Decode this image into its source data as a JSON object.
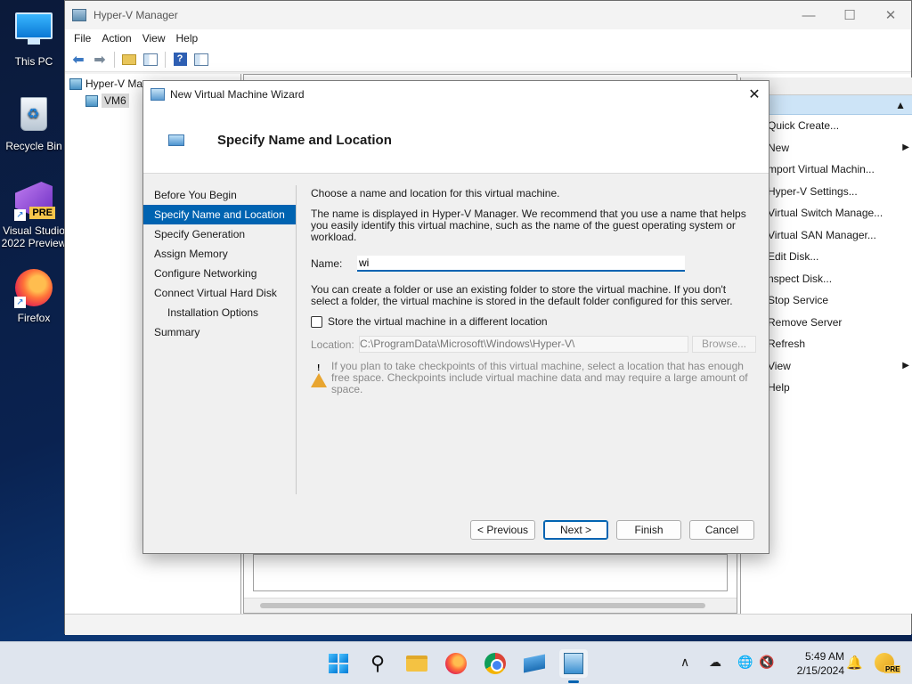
{
  "desktop": {
    "icons": [
      {
        "label": "This PC"
      },
      {
        "label": "Recycle Bin"
      },
      {
        "label": "Visual Studio 2022 Preview",
        "badge": "PRE"
      },
      {
        "label": "Firefox"
      }
    ]
  },
  "hyperv": {
    "title": "Hyper-V Manager",
    "menu": [
      "File",
      "Action",
      "View",
      "Help"
    ],
    "tree": {
      "root": "Hyper-V Ma",
      "child": "VM6"
    },
    "actions": {
      "header": "ns",
      "items": [
        {
          "label": "Quick Create..."
        },
        {
          "label": "New",
          "submenu": "▶"
        },
        {
          "label": "mport Virtual Machin..."
        },
        {
          "label": "Hyper-V Settings..."
        },
        {
          "label": "Virtual Switch Manage..."
        },
        {
          "label": "Virtual SAN Manager..."
        },
        {
          "label": "Edit Disk..."
        },
        {
          "label": "nspect Disk..."
        },
        {
          "label": "Stop Service"
        },
        {
          "label": "Remove Server"
        },
        {
          "label": "Refresh"
        },
        {
          "label": "View",
          "submenu": "▶"
        },
        {
          "label": "Help"
        }
      ]
    }
  },
  "wizard": {
    "title": "New Virtual Machine Wizard",
    "heading": "Specify Name and Location",
    "nav": [
      {
        "label": "Before You Begin"
      },
      {
        "label": "Specify Name and Location",
        "active": true
      },
      {
        "label": "Specify Generation"
      },
      {
        "label": "Assign Memory"
      },
      {
        "label": "Configure Networking"
      },
      {
        "label": "Connect Virtual Hard Disk"
      },
      {
        "label": "Installation Options",
        "indent": true
      },
      {
        "label": "Summary"
      }
    ],
    "intro": "Choose a name and location for this virtual machine.",
    "description": "The name is displayed in Hyper-V Manager. We recommend that you use a name that helps you easily identify this virtual machine, such as the name of the guest operating system or workload.",
    "name_label": "Name:",
    "name_value": "wi",
    "folder_text": "You can create a folder or use an existing folder to store the virtual machine. If you don't select a folder, the virtual machine is stored in the default folder configured for this server.",
    "checkbox_label": "Store the virtual machine in a different location",
    "location_label": "Location:",
    "location_value": "C:\\ProgramData\\Microsoft\\Windows\\Hyper-V\\",
    "browse_label": "Browse...",
    "warning_text": "If you plan to take checkpoints of this virtual machine, select a location that has enough free space. Checkpoints include virtual machine data and may require a large amount of space.",
    "buttons": {
      "previous": "< Previous",
      "next": "Next >",
      "finish": "Finish",
      "cancel": "Cancel"
    }
  },
  "taskbar": {
    "time": "5:49 AM",
    "date": "2/15/2024"
  },
  "colors": {
    "accent": "#0063b1",
    "selection": "#0063b1"
  }
}
